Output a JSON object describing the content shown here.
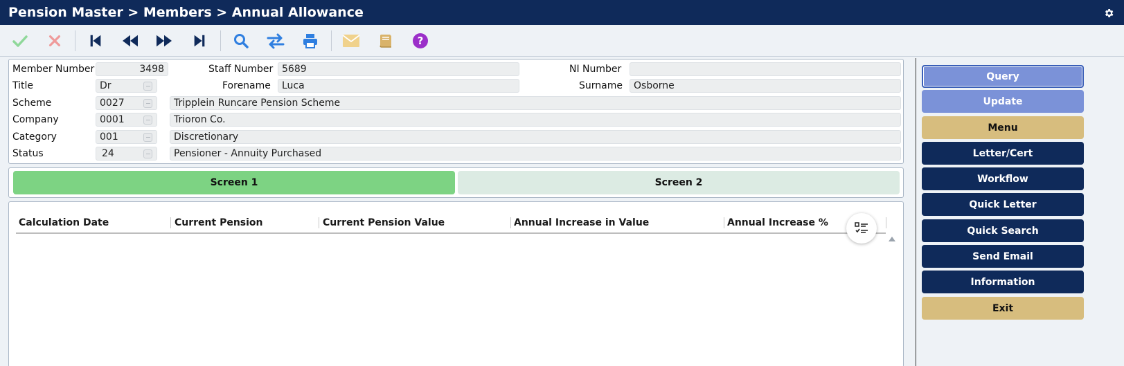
{
  "header": {
    "title": "Pension Master > Members > Annual Allowance",
    "settings_icon": "gear-icon"
  },
  "toolbar": {
    "icons": [
      "check-icon",
      "cancel-icon",
      "first-record-icon",
      "previous-record-icon",
      "next-record-icon",
      "last-record-icon",
      "search-icon",
      "swap-icon",
      "print-icon",
      "email-icon",
      "book-icon",
      "help-icon"
    ]
  },
  "member": {
    "member_number": {
      "label": "Member Number",
      "value": "3498"
    },
    "staff_number": {
      "label": "Staff Number",
      "value": "5689"
    },
    "ni_number": {
      "label": "NI Number",
      "value": ""
    },
    "title": {
      "label": "Title",
      "value": "Dr"
    },
    "forename": {
      "label": "Forename",
      "value": "Luca"
    },
    "surname": {
      "label": "Surname",
      "value": "Osborne"
    },
    "scheme": {
      "label": "Scheme",
      "code": "0027",
      "name": "Tripplein Runcare Pension Scheme"
    },
    "company": {
      "label": "Company",
      "code": "0001",
      "name": "Trioron Co."
    },
    "category": {
      "label": "Category",
      "code": "001",
      "name": "Discretionary"
    },
    "status": {
      "label": "Status",
      "code": "24",
      "name": "Pensioner - Annuity Purchased"
    }
  },
  "tabs": [
    {
      "label": "Screen 1",
      "active": true
    },
    {
      "label": "Screen 2",
      "active": false
    }
  ],
  "table": {
    "columns": [
      "Calculation Date",
      "Current Pension",
      "Current Pension Value",
      "Annual Increase in Value",
      "Annual Increase %"
    ],
    "rows": []
  },
  "sidebar": {
    "buttons": [
      {
        "label": "Query",
        "style": "blue"
      },
      {
        "label": "Update",
        "style": "blue"
      },
      {
        "label": "Menu",
        "style": "gold"
      },
      {
        "label": "Letter/Cert",
        "style": "navy"
      },
      {
        "label": "Workflow",
        "style": "navy"
      },
      {
        "label": "Quick Letter",
        "style": "navy"
      },
      {
        "label": "Quick Search",
        "style": "navy"
      },
      {
        "label": "Send Email",
        "style": "navy"
      },
      {
        "label": "Information",
        "style": "navy"
      },
      {
        "label": "Exit",
        "style": "gold"
      }
    ]
  },
  "colors": {
    "header": "#0f2a5a",
    "tab_active": "#7dd383",
    "tab_inactive": "#dcebe3",
    "button_blue": "#7b92d8",
    "button_gold": "#d7bd7e"
  }
}
